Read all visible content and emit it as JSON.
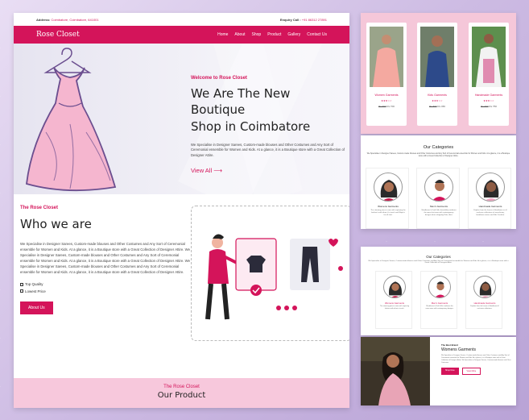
{
  "colors": {
    "accent": "#d4145a",
    "pink_band": "#f7c8dc",
    "background": "#d6c8e8"
  },
  "topbar": {
    "address_label": "Address:",
    "address_value": "Coimbatore, Coimbatore, 641001",
    "enquiry_label": "Enquiry Call :",
    "enquiry_value": "+91 86312 27891"
  },
  "nav": {
    "brand": "Rose Closet",
    "menu": [
      "Home",
      "About",
      "Shop",
      "Product",
      "Gallery",
      "Contact Us"
    ]
  },
  "hero": {
    "welcome": "Welcome to Rose Closet",
    "title_line1": "We Are The New Boutique",
    "title_line2": "Shop in Coimbatore",
    "description": "We Specialise in Designer Sarees, Custom-made blouses and Other Costumes and Any Sort of Ceremonial ensemble for Women and Kids. At a glance, it is a Boutique store with a Great Collection of Designer Attire.",
    "view_all": "View All  ⟶"
  },
  "about": {
    "subtitle": "The Rose Closet",
    "title": "Who we are",
    "description": "We Specialise in Designer Sarees, Custom-made blouses and Other Costumes and Any Sort of Ceremonial ensemble for Women and Kids. At a glance, it is a Boutique store with a Great Collection of Designer Attire. We Specialise in Designer Sarees, Custom-made blouses and Other Costumes and Any Sort of Ceremonial ensemble for Women and Kids. At a glance, it is a Boutique store with a Great Collection of Designer Attire. We Specialise in Designer Sarees, Custom-made blouses and Other Costumes and Any Sort of Ceremonial ensemble for Women and Kids. At a glance, it is a Boutique store with a Great Collection of Designer Attire.",
    "checks": [
      "Top Quality",
      "Lowest Price"
    ],
    "button": "About Us"
  },
  "product_band": {
    "subtitle": "The Rose Closet",
    "title": "Our Product"
  },
  "products": [
    {
      "name": "Women Garments",
      "stars": "★★★☆☆",
      "price_old": "Rs 900",
      "price": "Rs 700"
    },
    {
      "name": "Kids Garments",
      "stars": "★★★☆☆",
      "price_old": "Rs 600",
      "price": "Rs 450"
    },
    {
      "name": "Handmade Garments",
      "stars": "★★★☆☆",
      "price_old": "Rs 900",
      "price": "Rs 750"
    }
  ],
  "categories": {
    "title": "Our Categories",
    "description": "We Specialise in Designer Sarees, Custom-made blouses and Other Costumes and Any Sort of Ceremonial ensemble for Women and Kids. At a glance, it is a Boutique store with a Great Collection of Designer Attire.",
    "items": [
      {
        "name": "Womens Garments",
        "text": "The stunning pieces come with capturing the fashion's with ethnic & a touch and Wayin's for all shot."
      },
      {
        "name": "Men's Garments",
        "text": "Shadhaven's Kraft Gifts beautifully combines the mens knit wear with contemporary designs when shopping Flats, fiber."
      },
      {
        "name": "Handmade Garments",
        "text": "Explore from the house of Handloom as all exclusive collections of saree-lining, handloom sarees and Kids' Fashion."
      }
    ]
  },
  "categories_small": {
    "title": "Our Categories",
    "description": "We Specialise in Designer Sarees, Custom-made blouses and Other Costumes and Any Sort of Ceremonial ensemble for Women and Kids. At a glance, it is a Boutique store with a Great Collection of Designer Attire.",
    "items": [
      {
        "name": "Womens Garments",
        "text": "The stunning pieces come with capturing fashion with ethnic a touch."
      },
      {
        "name": "Men's Garments",
        "text": "Shadhaven's Kraft Gifts combines the mens wear with contemporary designs."
      },
      {
        "name": "Handmade Garments",
        "text": "Explore from the house of Handloom all exclusive collections."
      }
    ]
  },
  "feature": {
    "subtitle": "The Best Brand",
    "title": "Womens Garments",
    "description": "We Specialise in Designer Sarees, Custom-made blouses and Other Costumes and Any Sort of Ceremonial ensemble for Women and Kids. At a glance, it is a Boutique store with a Great Collection of Designer Attire. We Specialise in Designer Sarees, Custom-made blouses and Other Costumes.",
    "btn_primary": "Shop Now",
    "btn_secondary": "View More"
  }
}
